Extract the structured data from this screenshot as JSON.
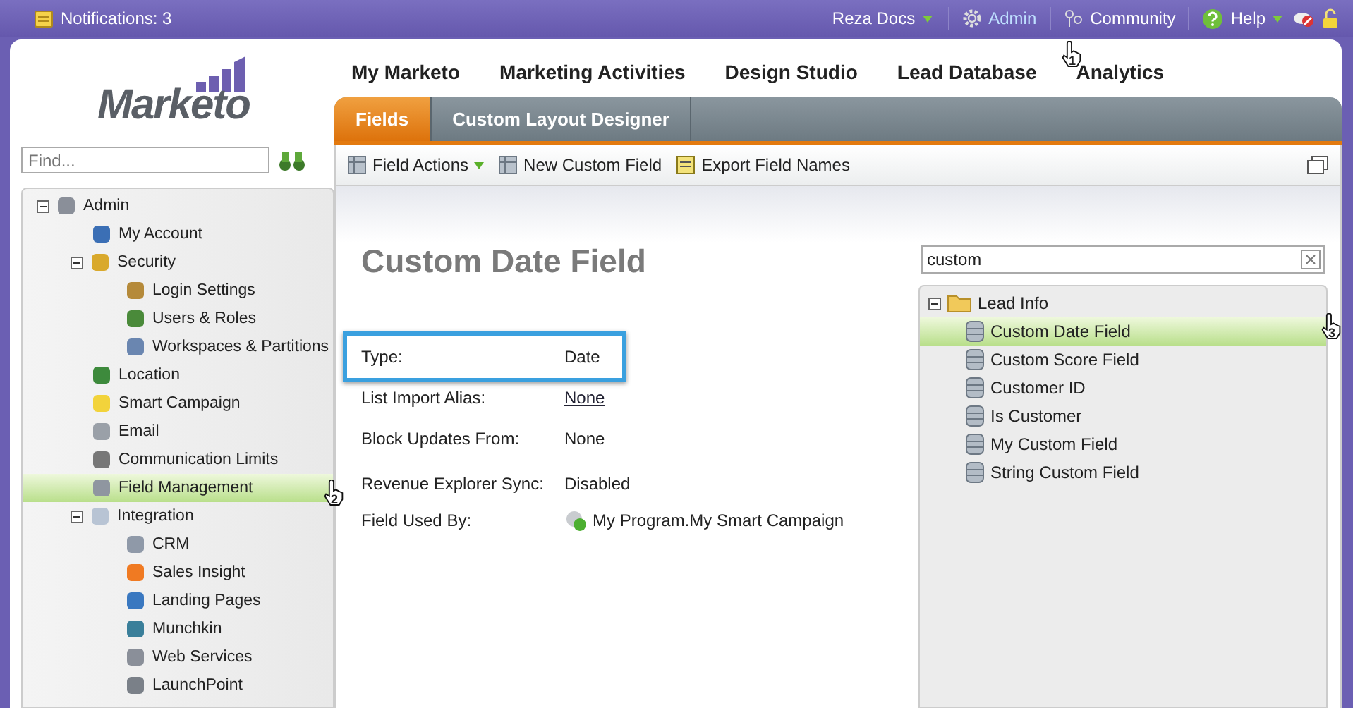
{
  "top_bar": {
    "notifications": "Notifications: 3",
    "links": [
      {
        "label": "Reza Docs",
        "kind": "menu",
        "selected": false
      },
      {
        "label": "Admin",
        "kind": "gear",
        "selected": true
      },
      {
        "label": "Community",
        "kind": "community",
        "selected": false
      },
      {
        "label": "Help",
        "kind": "help",
        "selected": false
      }
    ]
  },
  "logo": "Marketo",
  "find": {
    "placeholder": "Find..."
  },
  "sidebar": {
    "items": [
      {
        "label": "Admin",
        "selected": false,
        "expanded": true,
        "children": [
          {
            "label": "My Account",
            "selected": false
          },
          {
            "label": "Security",
            "selected": false,
            "expanded": true,
            "children": [
              {
                "label": "Login Settings",
                "selected": false
              },
              {
                "label": "Users & Roles",
                "selected": false
              },
              {
                "label": "Workspaces & Partitions",
                "selected": false
              }
            ]
          },
          {
            "label": "Location",
            "selected": false
          },
          {
            "label": "Smart Campaign",
            "selected": false
          },
          {
            "label": "Email",
            "selected": false
          },
          {
            "label": "Communication Limits",
            "selected": false
          },
          {
            "label": "Field Management",
            "selected": true
          },
          {
            "label": "Integration",
            "selected": false,
            "expanded": true,
            "children": [
              {
                "label": "CRM",
                "selected": false
              },
              {
                "label": "Sales Insight",
                "selected": false
              },
              {
                "label": "Landing Pages",
                "selected": false
              },
              {
                "label": "Munchkin",
                "selected": false
              },
              {
                "label": "Web Services",
                "selected": false
              },
              {
                "label": "LaunchPoint",
                "selected": false
              }
            ]
          }
        ]
      }
    ]
  },
  "nav": [
    {
      "label": "My Marketo"
    },
    {
      "label": "Marketing Activities"
    },
    {
      "label": "Design Studio"
    },
    {
      "label": "Lead Database"
    },
    {
      "label": "Analytics"
    }
  ],
  "tabs": [
    {
      "label": "Fields",
      "selected": true
    },
    {
      "label": "Custom Layout Designer",
      "selected": false
    }
  ],
  "toolbar": [
    {
      "label": "Field Actions",
      "kind": "menu"
    },
    {
      "label": "New Custom Field",
      "kind": "button"
    },
    {
      "label": "Export Field Names",
      "kind": "button"
    }
  ],
  "detail": {
    "title": "Custom Date Field",
    "properties": [
      {
        "label": "Type:",
        "value": "Date",
        "kind": "text",
        "highlighted": true
      },
      {
        "label": "List Import Alias:",
        "value": "None",
        "kind": "link",
        "highlighted": false
      },
      {
        "label": "Block Updates From:",
        "value": "None",
        "kind": "text",
        "highlighted": false
      },
      {
        "label": "Revenue Explorer Sync:",
        "value": "Disabled",
        "kind": "text",
        "highlighted": false
      },
      {
        "label": "Field Used By:",
        "value": "My Program.My Smart Campaign",
        "kind": "campaign",
        "highlighted": false
      }
    ]
  },
  "field_search": {
    "value": "custom"
  },
  "field_tree": {
    "label": "Lead Info",
    "expanded": true,
    "children": [
      {
        "label": "Custom Date Field",
        "selected": true
      },
      {
        "label": "Custom Score Field",
        "selected": false
      },
      {
        "label": "Customer ID",
        "selected": false
      },
      {
        "label": "Is Customer",
        "selected": false
      },
      {
        "label": "My Custom Field",
        "selected": false
      },
      {
        "label": "String Custom Field",
        "selected": false
      }
    ]
  },
  "callouts": [
    {
      "label": "1"
    },
    {
      "label": "2"
    },
    {
      "label": "3"
    }
  ]
}
